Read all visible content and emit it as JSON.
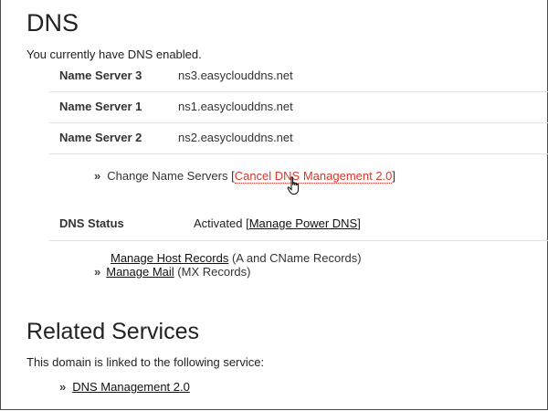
{
  "dns": {
    "title": "DNS",
    "status_text": "You currently have DNS enabled.",
    "name_servers": [
      {
        "label": "Name Server 3",
        "value": "ns3.easyclouddns.net"
      },
      {
        "label": "Name Server 1",
        "value": "ns1.easyclouddns.net"
      },
      {
        "label": "Name Server 2",
        "value": "ns2.easyclouddns.net"
      }
    ],
    "change_label": "Change Name Servers",
    "cancel_link": "Cancel DNS Management 2.0",
    "dns_status_label": "DNS Status",
    "dns_status_value": "Activated",
    "manage_power_dns": "Manage Power DNS",
    "manage_host_records": "Manage Host Records",
    "host_records_note": "(A and CName Records)",
    "manage_mail": "Manage Mail",
    "mail_note": "(MX Records)"
  },
  "related": {
    "title": "Related Services",
    "intro": "This domain is linked to the following service:",
    "service_link": "DNS Management 2.0"
  },
  "bullet_glyph": "»",
  "accent_color": "#d9372b"
}
